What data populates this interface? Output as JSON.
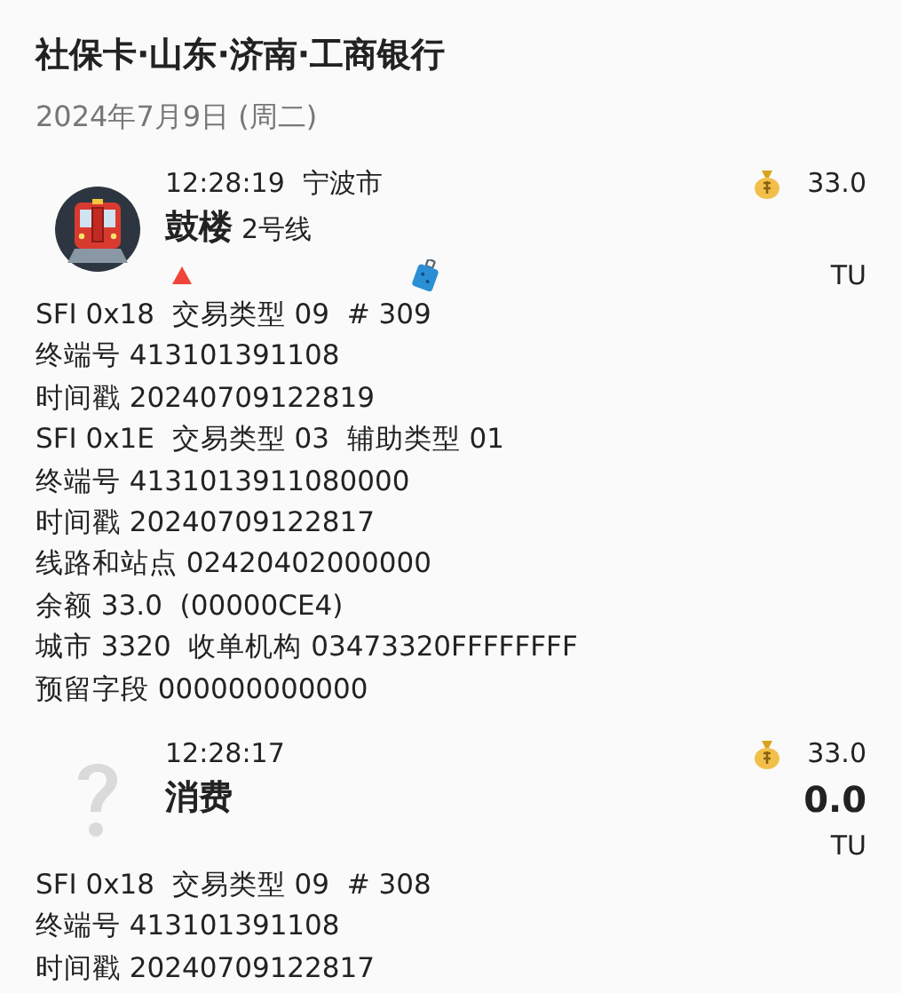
{
  "header": {
    "title": "社保卡·山东·济南·工商银行",
    "date": "2024年7月9日 (周二)"
  },
  "records": [
    {
      "kind": "metro",
      "time": "12:28:19",
      "city": "宁波市",
      "title": "鼓楼",
      "line": "2号线",
      "balance": "33.0",
      "unit": "TU",
      "marks": [
        {
          "kind": "triangle"
        },
        {
          "kind": "suitcase"
        }
      ],
      "details": [
        "SFI 0x18  交易类型 09  # 309",
        "终端号 413101391108",
        "时间戳 20240709122819",
        "SFI 0x1E  交易类型 03  辅助类型 01",
        "终端号 4131013911080000",
        "时间戳 20240709122817",
        "线路和站点 02420402000000",
        "余额 33.0  (00000CE4)",
        "城市 3320  收单机构 03473320FFFFFFFF",
        "预留字段 000000000000"
      ]
    },
    {
      "kind": "unknown",
      "time": "12:28:17",
      "title": "消费",
      "balance": "33.0",
      "amount": "0.0",
      "unit": "TU",
      "details": [
        "SFI 0x18  交易类型 09  # 308",
        "终端号 413101391108",
        "时间戳 20240709122817"
      ]
    }
  ]
}
